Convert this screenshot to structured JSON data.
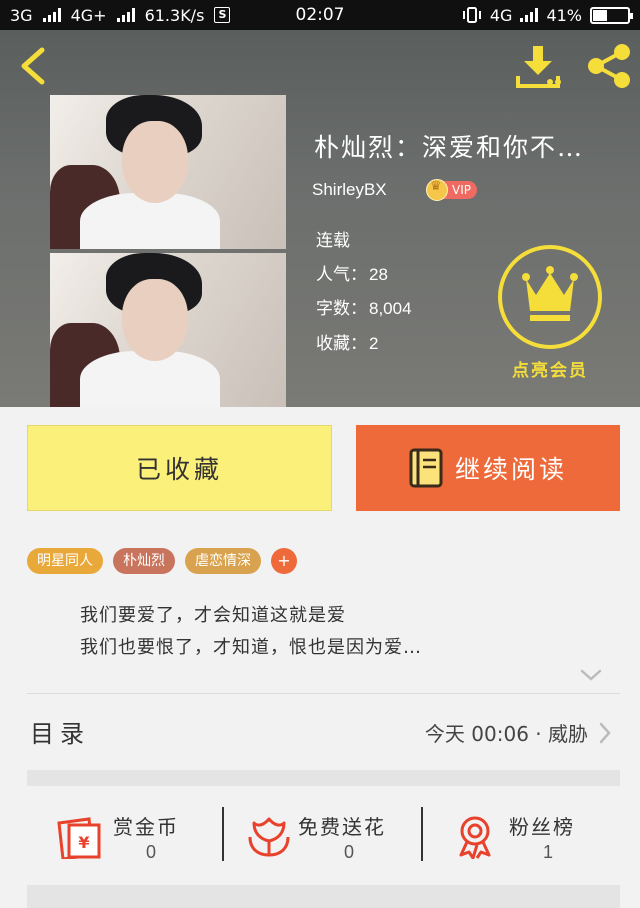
{
  "status_bar": {
    "network_1": "3G",
    "network_2": "4G+",
    "speed": "61.3K/s",
    "s_badge": "S",
    "time": "02:07",
    "network_3": "4G",
    "battery": "41%",
    "battery_level": 0.41
  },
  "book": {
    "title": "朴灿烈：深爱和你不…",
    "author": "ShirleyBX",
    "vip_label": "VIP",
    "status": "连载",
    "popularity_label": "人气：",
    "popularity": "28",
    "words_label": "字数：",
    "words": "8,004",
    "favorites_label": "收藏：",
    "favorites": "2"
  },
  "member": {
    "label": "点亮会员"
  },
  "buttons": {
    "collected": "已收藏",
    "continue_reading": "继续阅读"
  },
  "tags": [
    "明星同人",
    "朴灿烈",
    "虐恋情深"
  ],
  "tag_add": "+",
  "colors": {
    "tag_1": "#e9a83a",
    "tag_2": "#c9745d",
    "tag_3": "#d8a24e",
    "accent_orange": "#ee6a3b",
    "accent_yellow": "#fbf07a",
    "member_yellow": "#f5dd3a"
  },
  "intro": {
    "line1": "我们要爱了，才会知道这就是爱",
    "line2": "我们也要恨了，才知道，恨也是因为爱…"
  },
  "toc": {
    "label": "目录",
    "updated": "今天 00:06 · 威胁"
  },
  "actions": [
    {
      "label": "赏金币",
      "count": "0",
      "icon": "coin-envelope-icon"
    },
    {
      "label": "免费送花",
      "count": "0",
      "icon": "flower-icon"
    },
    {
      "label": "粉丝榜",
      "count": "1",
      "icon": "medal-icon"
    }
  ]
}
